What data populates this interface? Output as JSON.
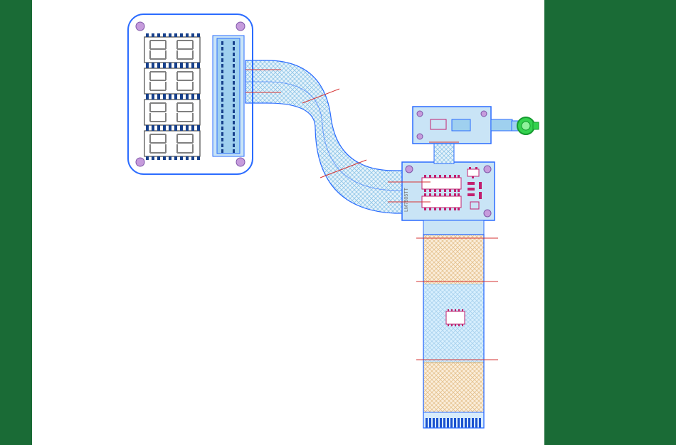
{
  "diagram": {
    "kind": "pcb-flex-rigid-layout",
    "description": "Flex/rigid printed‑circuit assembly: a left rigid display board with four dual 7‑segment displays and a long pin‑header, a central S‑shaped flex cable, a right rigid logic board with several SMT ICs, a small top connector board with a circular green connector, and a lower flex section with a single IC and an edge finger connector.",
    "colors": {
      "background": "#ffffff",
      "side_stripe": "#1a6b36",
      "board_outline": "#2b6cff",
      "board_fill": "#c9e4f6",
      "flex_region": "#bfe0f2",
      "flex_region_warm": "#f3d8af",
      "component_outline": "#0b3a8a",
      "component_body": "#ffffff",
      "pad": "#17408b",
      "silkscreen": "#7a7a7a",
      "mounting_hole": "#c69bdc",
      "guide_line": "#d63333",
      "connector_green": "#34d24e",
      "ic_outline": "#c21f6e",
      "edge_finger": "#1b52cf",
      "segment": "#808080"
    },
    "boards": {
      "display_board": {
        "shape": "rounded-rectangle",
        "corner_radius": 22,
        "mounting_holes": 4,
        "seven_segment_modules": 4,
        "header_pins": 40
      },
      "logic_board": {
        "ics": [
          {
            "package": "SOT",
            "pins": 6
          },
          {
            "package": "SOIC",
            "pins": 16
          },
          {
            "package": "SOIC",
            "pins": 16
          }
        ],
        "passives": 10
      },
      "connector_board_small": {
        "connector_type": "circular",
        "connector_color": "#34d24e"
      },
      "flex_lower": {
        "ics": [
          {
            "package": "SOIC",
            "pins": 16
          }
        ],
        "edge_finger_contacts": 22
      }
    },
    "flex_cable": {
      "shape": "S-curve",
      "hatch": "cross"
    },
    "labels": {
      "component_label": "LM7805TT"
    }
  }
}
